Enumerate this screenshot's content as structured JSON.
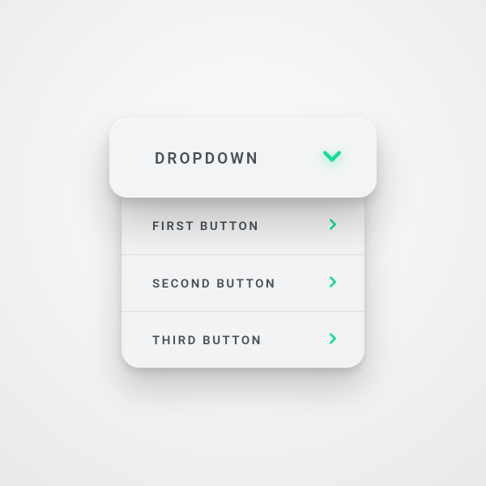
{
  "accent": "#16dd97",
  "dropdown": {
    "trigger_label": "DROPDOWN",
    "items": [
      {
        "label": "FIRST BUTTON"
      },
      {
        "label": "SECOND BUTTON"
      },
      {
        "label": "THIRD BUTTON"
      }
    ]
  },
  "icons": {
    "chevron_down": "chevron-down-icon",
    "chevron_right": "chevron-right-icon"
  }
}
